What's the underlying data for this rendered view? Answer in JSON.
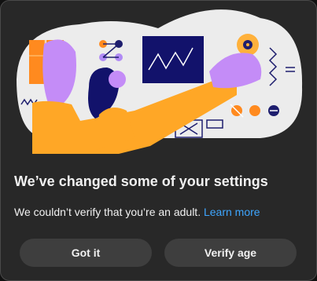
{
  "dialog": {
    "title": "We’ve changed some of your settings",
    "message": "We couldn’t verify that you’re an adult.",
    "learn_more_label": "Learn more",
    "buttons": {
      "got_it": "Got it",
      "verify_age": "Verify age"
    }
  },
  "colors": {
    "dialog_bg": "#282828",
    "button_bg": "#3e3e3e",
    "link": "#3ea6ff",
    "text": "#f1f1f1"
  }
}
